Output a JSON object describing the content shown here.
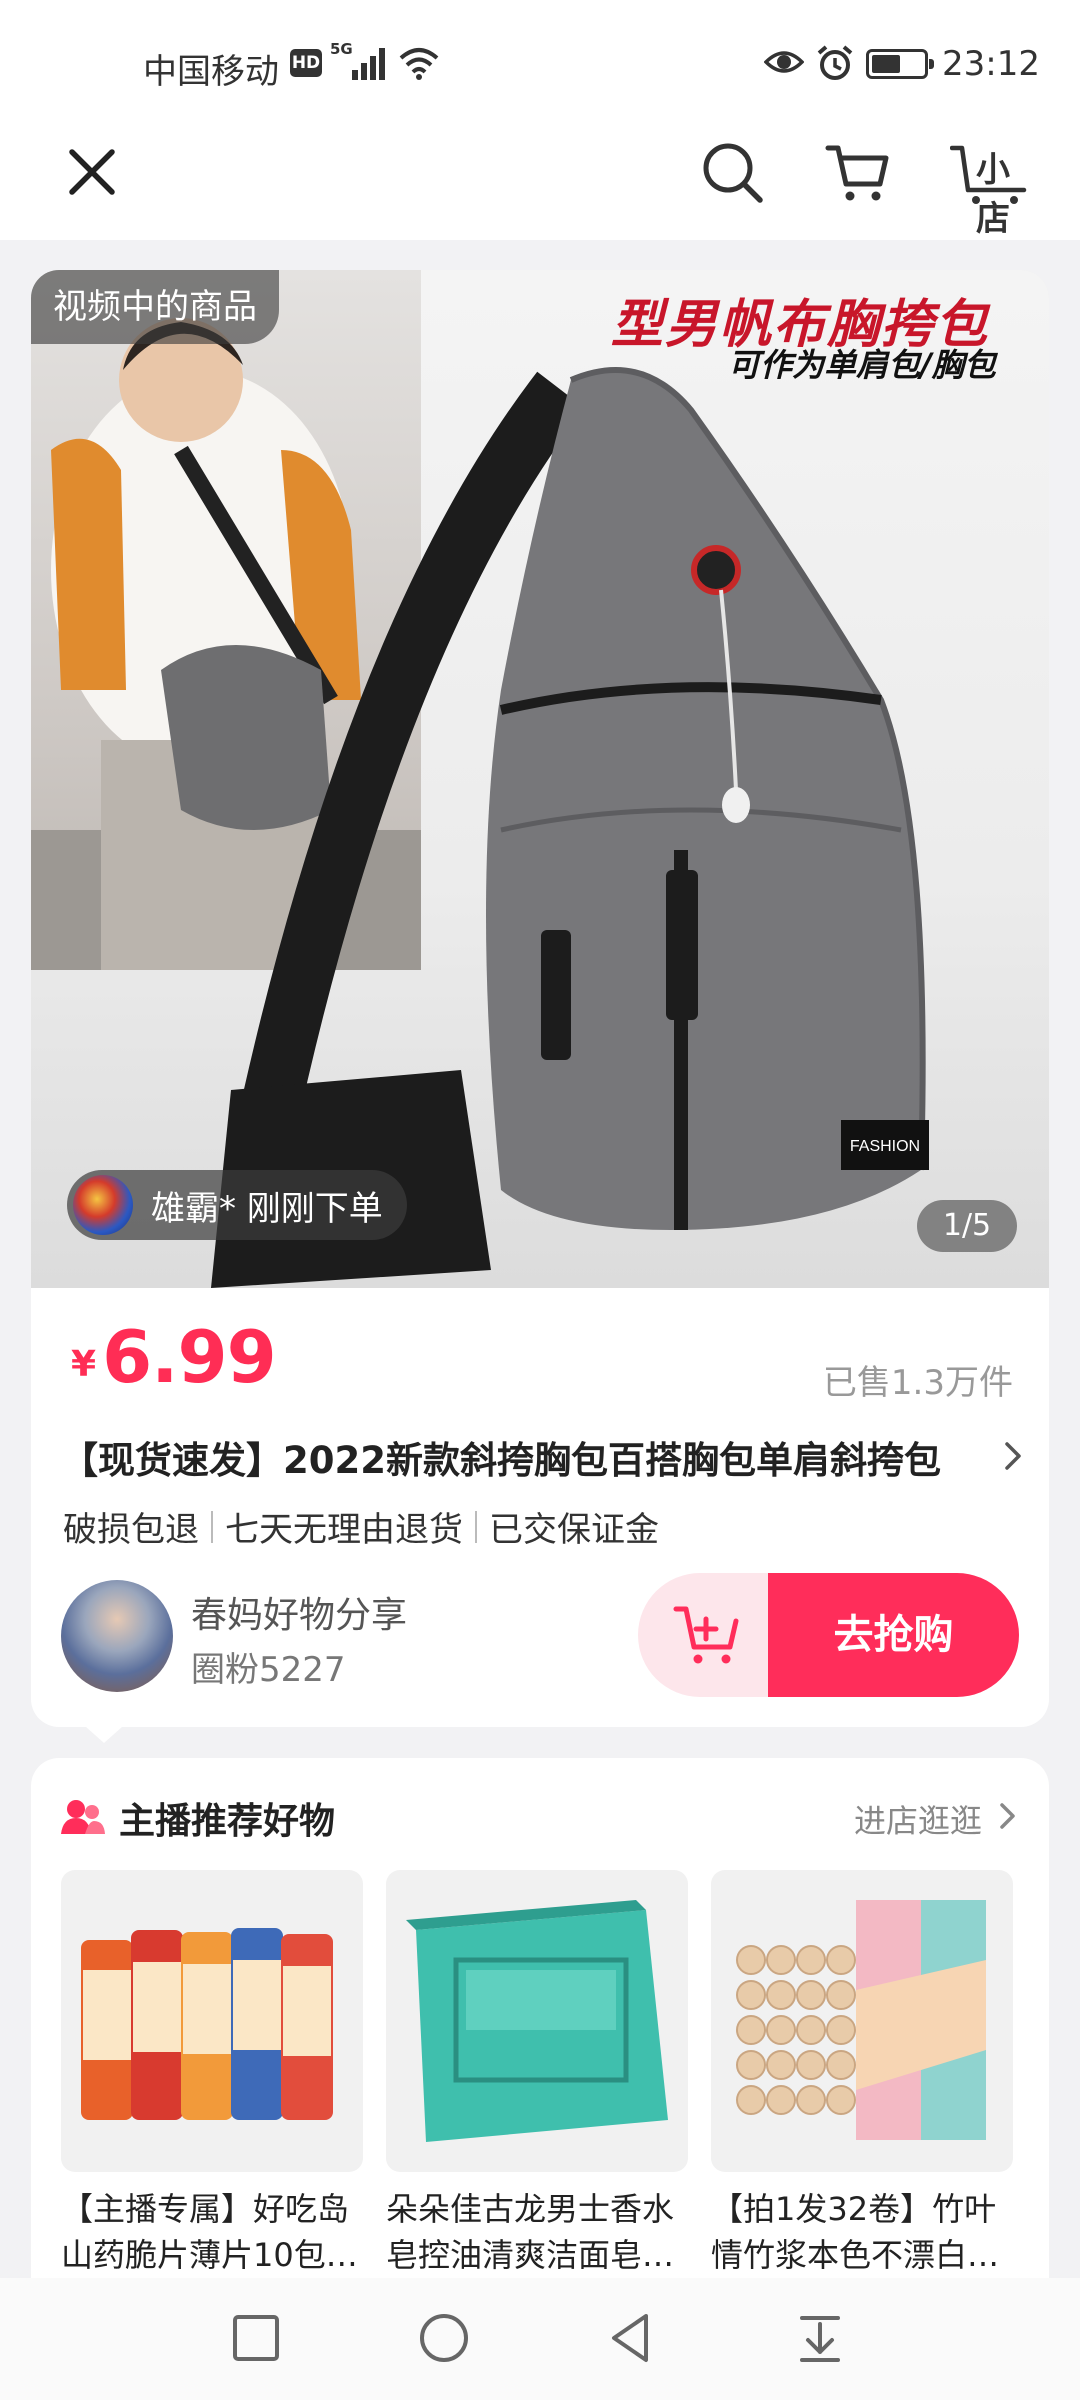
{
  "status_bar": {
    "carrier": "中国移动",
    "hd": "HD",
    "network": "5G",
    "time": "23:12",
    "battery_level": 0.55,
    "icons": [
      "signal-icon",
      "wifi-icon",
      "eye-icon",
      "alarm-icon",
      "battery-icon"
    ]
  },
  "top_nav": {
    "close_icon": "close-icon",
    "search_icon": "search-icon",
    "cart_icon": "cart-icon",
    "shop_label": "小店"
  },
  "product": {
    "video_badge": "视频中的商品",
    "promo_title": "型男帆布胸挎包",
    "promo_subtitle": "可作为单肩包/胸包",
    "recent_order": "雄霸* 刚刚下单",
    "page_indicator": "1/5",
    "price_symbol": "¥",
    "price": "6.99",
    "sold": "已售1.3万件",
    "title": "【现货速发】2022新款斜挎胸包百搭胸包单肩斜挎包",
    "services": [
      "破损包退",
      "七天无理由退货",
      "已交保证金"
    ],
    "seller_name": "春妈好物分享",
    "seller_fans": "圈粉5227",
    "add_to_cart_icon": "add-cart-icon",
    "buy_label": "去抢购",
    "accent_color": "#ff2d5a"
  },
  "recommend": {
    "title": "主播推荐好物",
    "more_label": "进店逛逛",
    "items": [
      {
        "name": "【主播专属】好吃岛山药脆片薄片10包…"
      },
      {
        "name": "朵朵佳古龙男士香水皂控油清爽洁面皂…"
      },
      {
        "name": "【拍1发32卷】竹叶情竹浆本色不漂白…"
      }
    ]
  },
  "system_nav": {
    "buttons": [
      "recents-icon",
      "home-icon",
      "back-icon",
      "notification-pull-icon"
    ]
  }
}
